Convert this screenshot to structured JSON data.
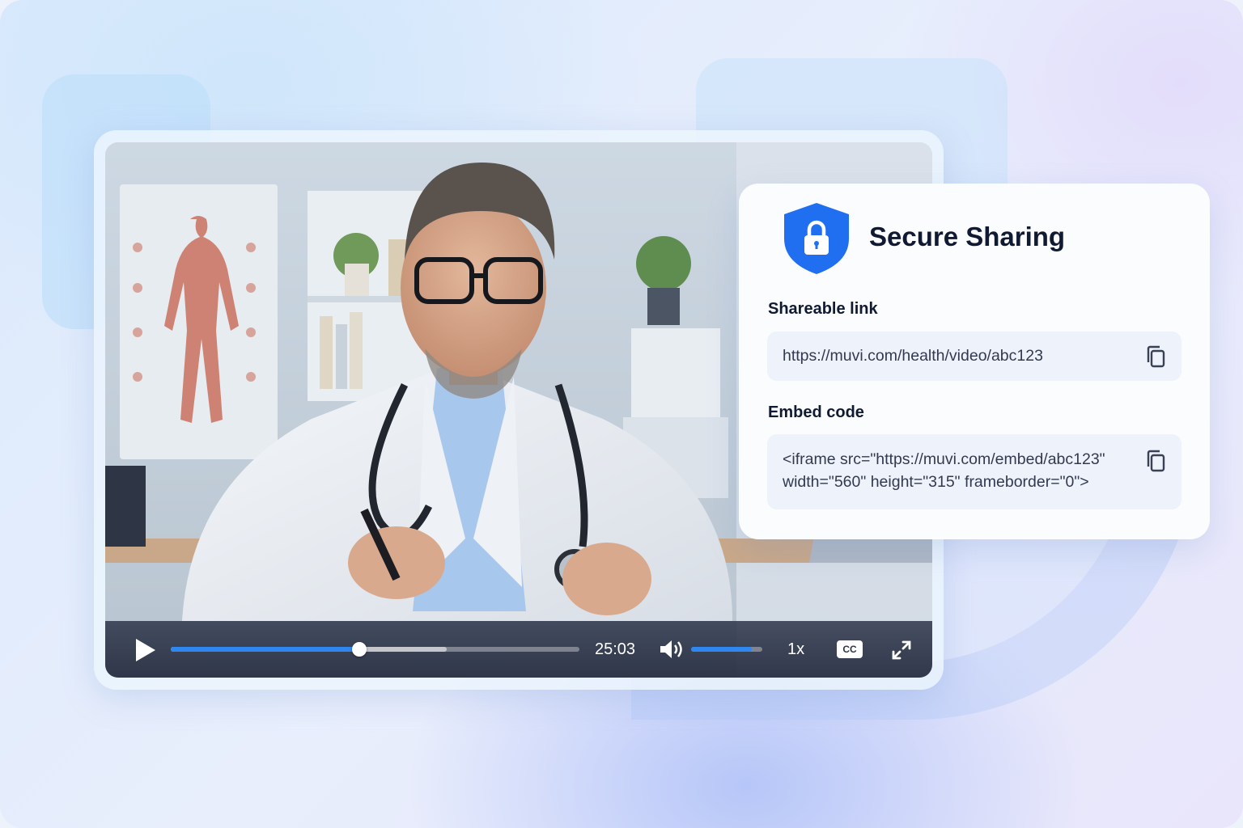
{
  "player": {
    "current_time": "25:03",
    "progress_fraction": 0.462,
    "buffered_fraction": 0.675,
    "volume_fraction": 0.85,
    "speed": "1x",
    "captions_label": "CC",
    "accent_color": "#2f87f0"
  },
  "share_card": {
    "title": "Secure Sharing",
    "shield_color": "#1f6ff0",
    "link_label": "Shareable link",
    "link_value": "https://muvi.com/health/video/abc123",
    "embed_label": "Embed code",
    "embed_line1": "<iframe src=\"https://muvi.com/embed/abc123\"",
    "embed_line2": "width=\"560\" height=\"315\" frameborder=\"0\">"
  }
}
